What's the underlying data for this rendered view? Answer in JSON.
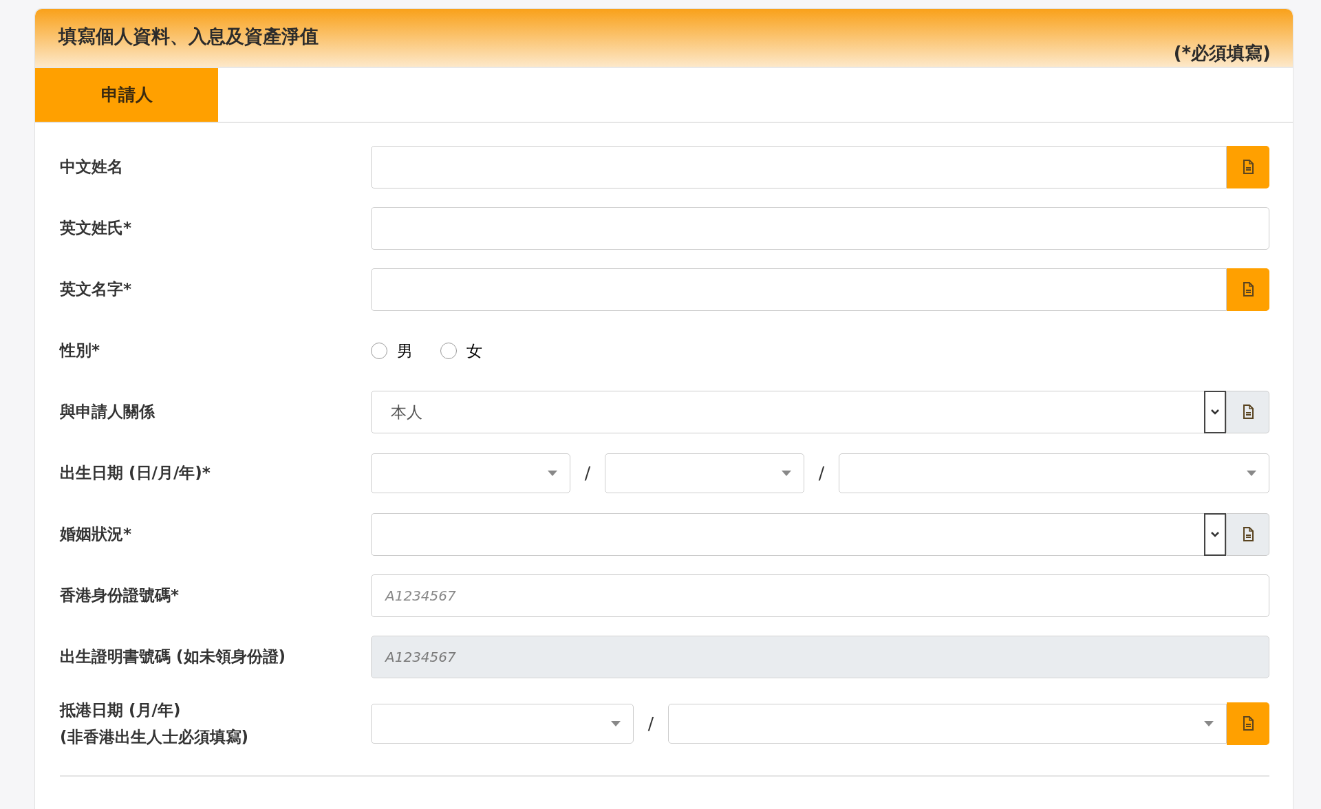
{
  "header": {
    "title": "填寫個人資料、入息及資產淨值",
    "required_note": "(*必須填寫)"
  },
  "tabs": [
    {
      "label": "申請人",
      "selected": true
    }
  ],
  "fields": [
    {
      "kind": "text",
      "label": "中文姓名",
      "disabled": false,
      "doc_button": true,
      "doc_button_highlighted": true
    },
    {
      "kind": "text",
      "label": "英文姓氏*",
      "disabled": false
    },
    {
      "kind": "text",
      "label": "英文名字*",
      "disabled": false,
      "doc_button": true,
      "doc_button_highlighted": true
    },
    {
      "kind": "radio",
      "label": "性別*",
      "options": [
        {
          "label": "男",
          "selected": false
        },
        {
          "label": "女",
          "selected": false
        }
      ]
    },
    {
      "kind": "select",
      "label": "與申請人關係",
      "value": "本人",
      "doc_button": true,
      "doc_button_highlighted": false
    },
    {
      "kind": "dropdowns",
      "label": "出生日期 (日/月/年)*",
      "segments": [
        {
          "kind": "dropdown"
        },
        {
          "kind": "separator",
          "text": "/"
        },
        {
          "kind": "dropdown"
        },
        {
          "kind": "separator",
          "text": "/"
        },
        {
          "kind": "dropdown"
        }
      ]
    },
    {
      "kind": "select",
      "label": "婚姻狀況*",
      "doc_button": true,
      "doc_button_highlighted": false
    },
    {
      "kind": "text",
      "label": "香港身份證號碼*",
      "placeholder": "A1234567",
      "disabled": false
    },
    {
      "kind": "text",
      "label": "出生證明書號碼 (如未領身份證)",
      "placeholder": "A1234567",
      "disabled": true
    },
    {
      "kind": "dropdowns",
      "label": "抵港日期 (月/年)",
      "note": "(非香港出生人士必須填寫)",
      "segments": [
        {
          "kind": "dropdown"
        },
        {
          "kind": "separator",
          "text": "/"
        },
        {
          "kind": "dropdown"
        }
      ],
      "doc_button": true,
      "doc_button_highlighted": true
    }
  ]
}
